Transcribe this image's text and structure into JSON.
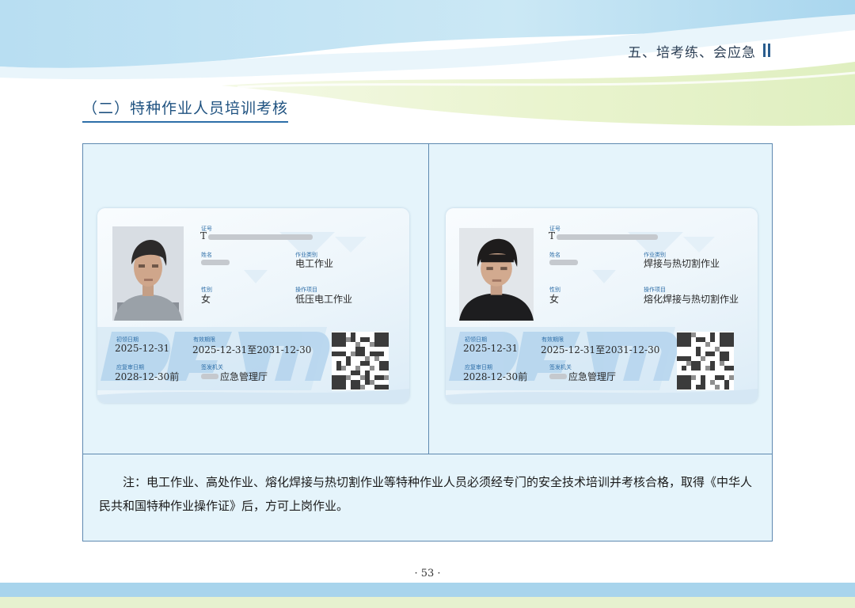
{
  "header": {
    "section": "五、培考练、会应急"
  },
  "title": "（二）特种作业人员培训考核",
  "cards": [
    {
      "labels": {
        "id": "证号",
        "name": "姓名",
        "category": "作业类别",
        "gender": "性别",
        "item": "操作项目",
        "issue": "初领日期",
        "valid": "有效期限",
        "review": "应复审日期",
        "authority": "签发机关"
      },
      "id_prefix": "T",
      "category": "电工作业",
      "gender": "女",
      "item": "低压电工作业",
      "issue_date": "2025-12-31",
      "valid_period": "2025-12-31至2031-12-30",
      "review_date": "2028-12-30前",
      "authority_suffix": "应急管理厅"
    },
    {
      "labels": {
        "id": "证号",
        "name": "姓名",
        "category": "作业类别",
        "gender": "性别",
        "item": "操作项目",
        "issue": "初领日期",
        "valid": "有效期限",
        "review": "应复审日期",
        "authority": "签发机关"
      },
      "id_prefix": "T",
      "category": "焊接与热切割作业",
      "gender": "女",
      "item": "熔化焊接与热切割作业",
      "issue_date": "2025-12-31",
      "valid_period": "2025-12-31至2031-12-30",
      "review_date": "2028-12-30前",
      "authority_suffix": "应急管理厅"
    }
  ],
  "note": "注：电工作业、高处作业、熔化焊接与热切割作业等特种作业人员必须经专门的安全技术培训并考核合格，取得《中华人民共和国特种作业操作证》后，方可上岗作业。",
  "page_number": "· 53 ·",
  "colors": {
    "title_blue": "#1f5280",
    "frame_border": "#5e89b0",
    "panel_bg": "#e5f4fb",
    "label_blue": "#2f6fa8"
  }
}
